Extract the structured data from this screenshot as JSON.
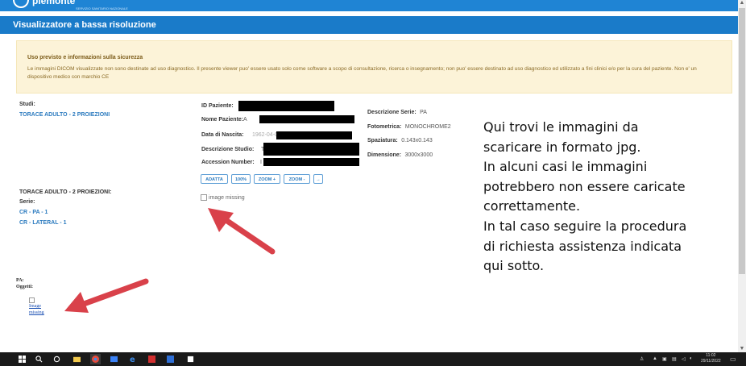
{
  "brand": {
    "name": "piemonte",
    "tagline": "SERVIZIO SANITARIO NAZIONALE"
  },
  "titlebar": {
    "title": "Visualizzatore a bassa risoluzione"
  },
  "warning": {
    "title": "Uso previsto e informazioni sulla sicurezza",
    "text": "Le immagini DICOM visualizzate non sono destinate ad uso diagnostico. Il presente viewer puo' essere usato solo come software a scopo di consultazione, ricerca o insegnamento; non puo' essere destinato ad uso diagnostico ed utilizzato a fini clinici e/o per la cura del paziente. Non e' un dispositivo medico con marchio CE"
  },
  "studies": {
    "label": "Studi:",
    "item": "TORACE ADULTO - 2 PROIEZIONI"
  },
  "patient": {
    "id_label": "ID Paziente:",
    "name_label": "Nome Paziente:",
    "name_partial": "A",
    "birth_label": "Data di Nascita:",
    "birth_partial": "1962-04-07",
    "study_desc_label": "Descrizione Studio:",
    "study_desc_partial": "T",
    "accession_label": "Accession Number:",
    "accession_partial": "I"
  },
  "series_info": {
    "desc_label": "Descrizione Serie:",
    "desc_value": "PA",
    "photometric_label": "Fotometrica:",
    "photometric_value": "MONOCHROME2",
    "spacing_label": "Spaziatura:",
    "spacing_value": "0.143x0.143",
    "dimension_label": "Dimensione:",
    "dimension_value": "3000x3000"
  },
  "controls": {
    "fit": "ADATTA",
    "zoom100": "100%",
    "zoom_in": "ZOOM +",
    "zoom_out": "ZOOM -",
    "next": "→"
  },
  "series_panel": {
    "study_title": "TORACE ADULTO - 2 PROIEZIONI:",
    "series_label": "Serie:",
    "items": [
      "CR - PA - 1",
      "CR - LATERAL - 1"
    ]
  },
  "main_image": {
    "alt": "image missing"
  },
  "objects": {
    "pa_label": "PA:",
    "objects_label": "Oggetti:",
    "thumb_alt_line1": "Image",
    "thumb_alt_line2": "missing"
  },
  "callout": {
    "lines": [
      "Qui trovi le immagini da",
      "scaricare in formato jpg.",
      "In alcuni casi le immagini",
      "potrebbero non essere caricate",
      "correttamente.",
      "In tal caso seguire la procedura",
      "di richiesta assistenza indicata",
      "qui sotto."
    ]
  },
  "taskbar": {
    "time": "11:02",
    "date": "29/11/2022"
  },
  "colors": {
    "header_blue": "#1a7bc9",
    "link_blue": "#2c7bbf",
    "warning_bg": "#fcf3d8",
    "arrow_red": "#d9414a",
    "taskbar": "#1a1a1a"
  }
}
